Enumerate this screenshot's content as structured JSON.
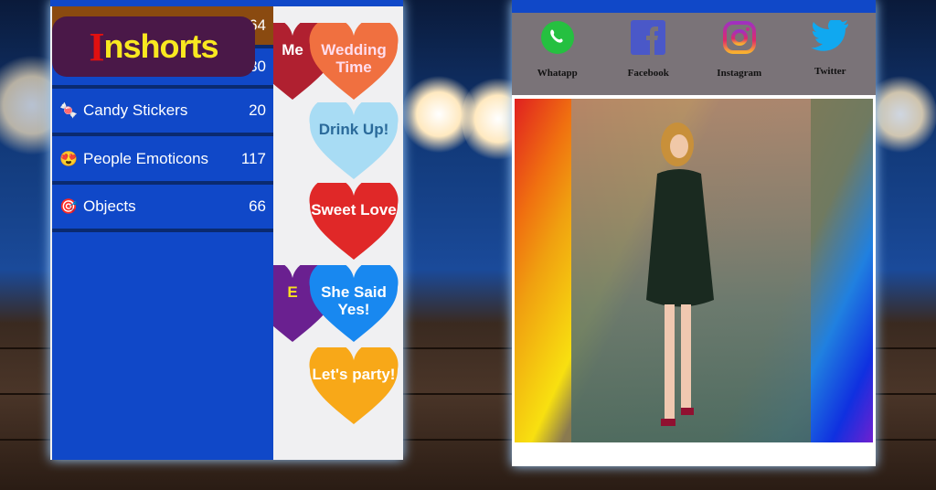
{
  "brand": {
    "logo_text": "Inshorts"
  },
  "left_app": {
    "drawer_items": [
      {
        "label": "",
        "count": "64",
        "icon": "category-icon"
      },
      {
        "label": "",
        "count": "30",
        "icon": "category-icon"
      },
      {
        "label": "Candy Stickers",
        "count": "20",
        "icon": "candy-icon",
        "glyph": "🍬"
      },
      {
        "label": "People Emoticons",
        "count": "117",
        "icon": "heart-eyes-emoji-icon",
        "glyph": "😍"
      },
      {
        "label": "Objects",
        "count": "66",
        "icon": "target-icon",
        "glyph": "🎯"
      }
    ],
    "stickers": [
      {
        "text": "Me",
        "color": "#b02030",
        "fg": "#fff"
      },
      {
        "text": "Wedding Time",
        "color": "#f07040",
        "fg": "#fde"
      },
      {
        "text": "Drink Up!",
        "color": "#a8dcf4",
        "fg": "#2a6a9a"
      },
      {
        "text": "Sweet Love",
        "color": "#e02828",
        "fg": "#fff"
      },
      {
        "text": "E",
        "color": "#6a2090",
        "fg": "#f8e020"
      },
      {
        "text": "She Said Yes!",
        "color": "#1888f0",
        "fg": "#fff"
      },
      {
        "text": "Let's party!",
        "color": "#f8a818",
        "fg": "#fff"
      }
    ]
  },
  "right_app": {
    "share": [
      {
        "label": "Whatapp",
        "icon": "whatsapp-icon",
        "color": "#25c040"
      },
      {
        "label": "Facebook",
        "icon": "facebook-icon",
        "color": "#4a58c8"
      },
      {
        "label": "Instagram",
        "icon": "instagram-icon",
        "color": "#d02a8a"
      },
      {
        "label": "Twitter",
        "icon": "twitter-icon",
        "color": "#10a8f0"
      }
    ]
  },
  "colors": {
    "primary": "#1048c8",
    "drawer_selected": "#8a4a10",
    "share_bar": "#7a7378"
  }
}
